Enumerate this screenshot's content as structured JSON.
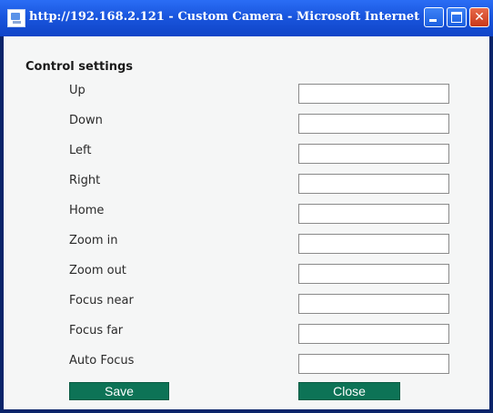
{
  "window": {
    "title": "http://192.168.2.121 - Custom Camera - Microsoft Internet ...",
    "colors": {
      "titlebar": "#1a56de",
      "button": "#0d7356",
      "close": "#c9381a"
    }
  },
  "form": {
    "section_title": "Control settings",
    "fields": [
      {
        "label": "Up",
        "value": ""
      },
      {
        "label": "Down",
        "value": ""
      },
      {
        "label": "Left",
        "value": ""
      },
      {
        "label": "Right",
        "value": ""
      },
      {
        "label": "Home",
        "value": ""
      },
      {
        "label": "Zoom in",
        "value": ""
      },
      {
        "label": "Zoom out",
        "value": ""
      },
      {
        "label": "Focus near",
        "value": ""
      },
      {
        "label": "Focus far",
        "value": ""
      },
      {
        "label": "Auto Focus",
        "value": ""
      }
    ],
    "save_label": "Save",
    "close_label": "Close"
  },
  "icons": [
    "ie-page-icon",
    "minimize-icon",
    "maximize-icon",
    "close-icon"
  ]
}
